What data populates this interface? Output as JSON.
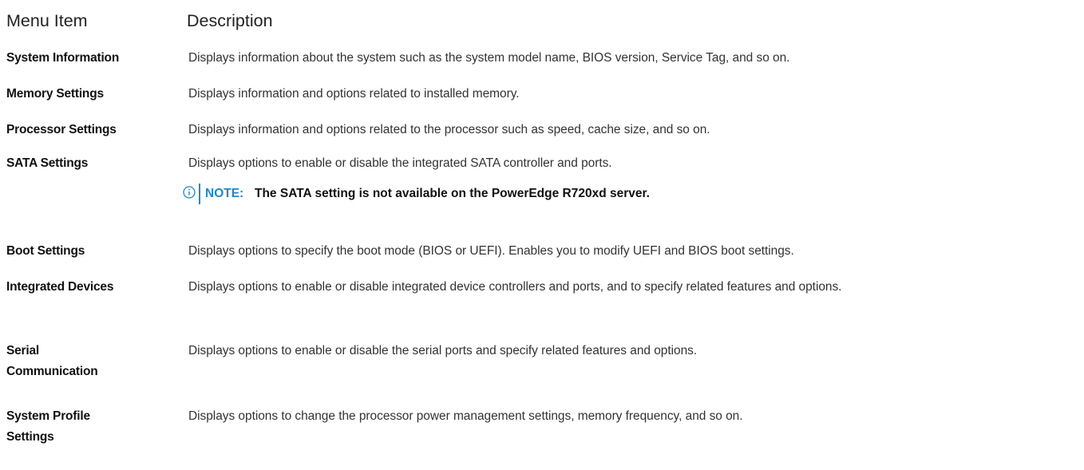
{
  "header": {
    "menu_item": "Menu Item",
    "description": "Description"
  },
  "rows": [
    {
      "term": "System Information",
      "desc": "Displays information about the system such as the system model name, BIOS version, Service Tag, and so on."
    },
    {
      "term": "Memory Settings",
      "desc": "Displays information and options related to installed memory."
    },
    {
      "term": "Processor Settings",
      "desc": "Displays information and options related to the processor such as speed, cache size, and so on."
    },
    {
      "term": "SATA Settings",
      "desc": "Displays options to enable or disable the integrated SATA controller and ports."
    },
    {
      "term": "Boot Settings",
      "desc": "Displays options to specify the boot mode (BIOS or UEFI). Enables you to modify UEFI and BIOS boot settings."
    },
    {
      "term": "Integrated Devices",
      "desc": "Displays options to enable or disable integrated device controllers and ports, and to specify related features and options."
    },
    {
      "term": "Serial Communication",
      "desc": "Displays options to enable or disable the serial ports and specify related features and options."
    },
    {
      "term": "System Profile Settings",
      "desc": "Displays options to change the processor power management settings, memory frequency, and so on."
    }
  ],
  "note": {
    "icon": "info-icon",
    "label": "NOTE:",
    "text": "The SATA setting is not available on the PowerEdge R720xd server."
  },
  "colors": {
    "accent": "#1e88c7",
    "text": "#222222"
  }
}
